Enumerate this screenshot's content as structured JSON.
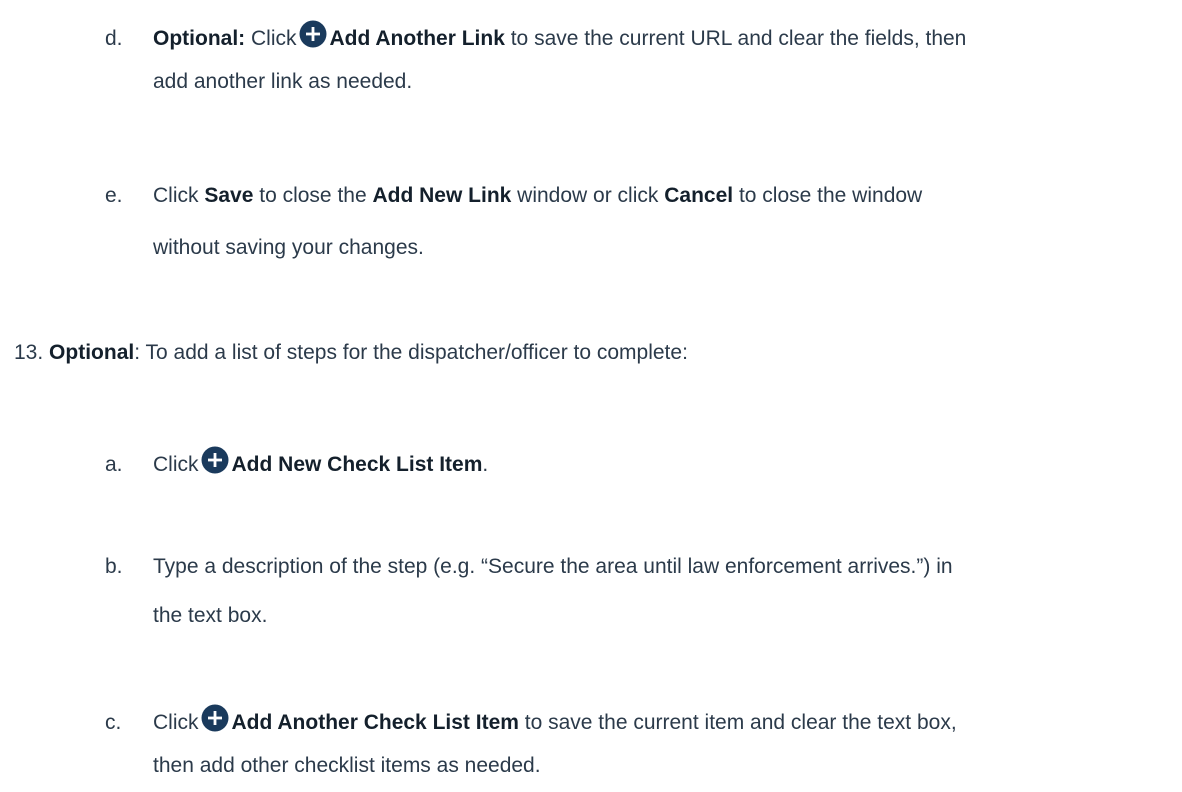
{
  "icons": {
    "add": "plus-circle-icon"
  },
  "colors": {
    "icon_fill": "#1a3a5c",
    "text": "#2b3a4a",
    "bold_text": "#14202c"
  },
  "item_d": {
    "marker": "d.",
    "optional_label": "Optional:",
    "click": "Click",
    "action": "Add Another Link",
    "rest_line1": "to save the current URL and clear the fields, then",
    "line2": "add another link as needed."
  },
  "item_e": {
    "marker": "e.",
    "click": "Click",
    "save": "Save",
    "t1": "to close the",
    "window_name": "Add New Link",
    "t2": "window or click",
    "cancel": "Cancel",
    "t3": "to close the window",
    "line2": "without saving your changes."
  },
  "step13": {
    "number": "13.",
    "optional": "Optional",
    "text": ": To add a list of steps for the dispatcher/officer to complete:"
  },
  "item_a": {
    "marker": "a.",
    "click": "Click",
    "action": "Add New Check List Item",
    "period": "."
  },
  "item_b": {
    "marker": "b.",
    "line1": "Type a description of the step (e.g. “Secure the area until law enforcement arrives.”) in",
    "line2": "the text box."
  },
  "item_c": {
    "marker": "c.",
    "click": "Click",
    "action": "Add Another Check List Item",
    "rest_line1": "to save the current item and clear the text box,",
    "line2": "then add other checklist items as needed."
  }
}
